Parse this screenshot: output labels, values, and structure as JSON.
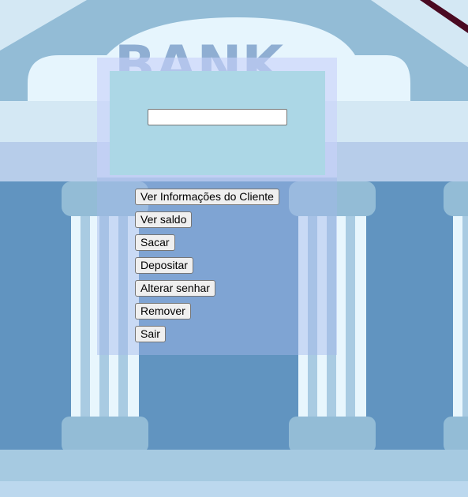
{
  "bank_logo_text": "BANK",
  "search": {
    "value": "",
    "placeholder": ""
  },
  "menu": {
    "buttons": [
      {
        "label": "Ver Informações do Cliente"
      },
      {
        "label": "Ver saldo"
      },
      {
        "label": "Sacar"
      },
      {
        "label": "Depositar"
      },
      {
        "label": "Alterar senhar"
      },
      {
        "label": "Remover"
      },
      {
        "label": "Sair"
      }
    ]
  },
  "colors": {
    "sky": "#d4e8f4",
    "roof": "#93bcd6",
    "dome": "#e6f5fd",
    "wall": "#6194c0",
    "column_light": "#e8f6fd",
    "column_mid": "#a9cbe2",
    "base": "#a6cae1",
    "accent_maroon": "#4a0a22",
    "panel": "#acd7e6"
  }
}
